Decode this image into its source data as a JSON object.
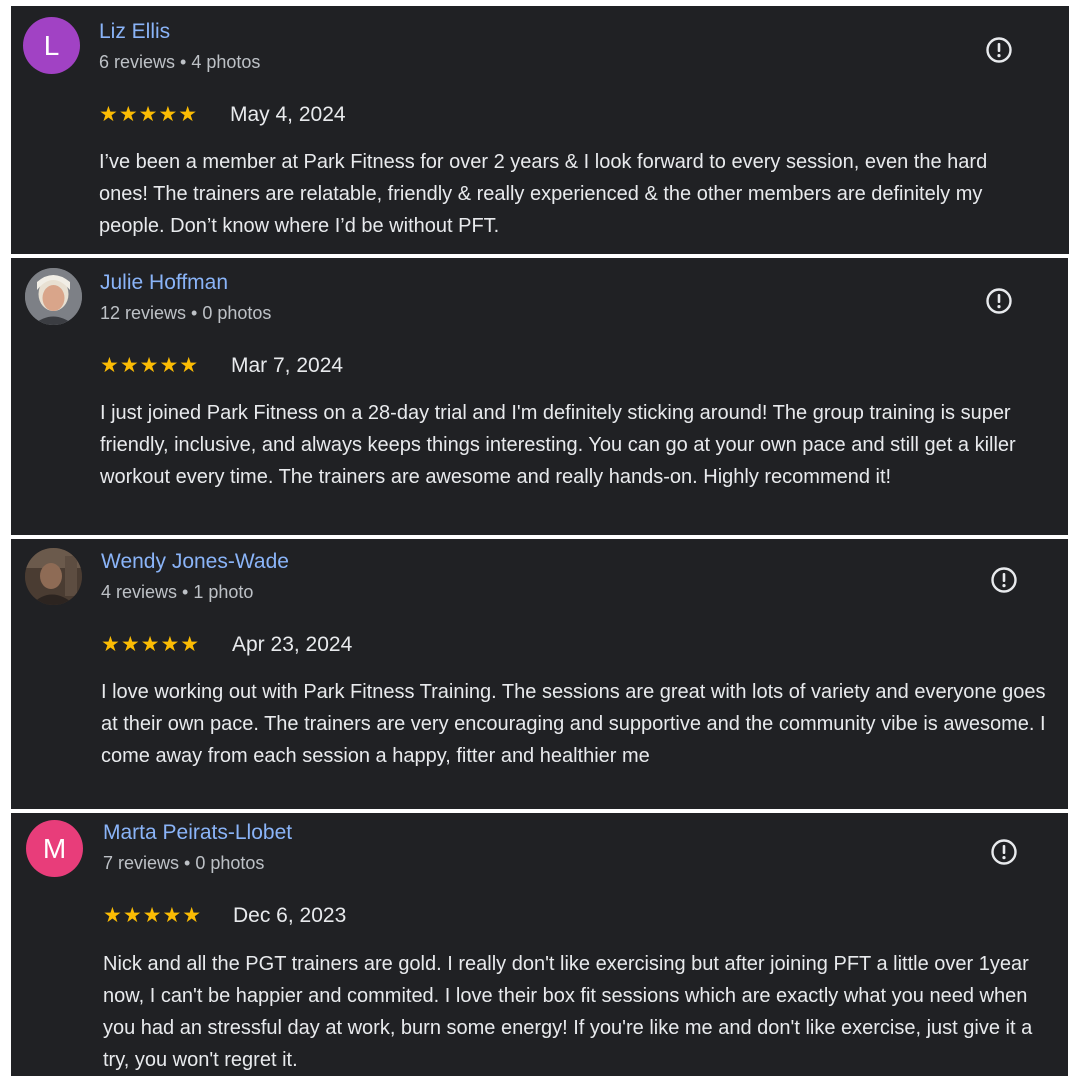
{
  "colors": {
    "card_background": "#202124",
    "reviewer_name": "#8ab4f8",
    "meta_text": "#bdc1c6",
    "body_text": "#e8eaed",
    "star": "#fbbc04",
    "avatar_purple": "#a142c4",
    "avatar_pink": "#e83d7a"
  },
  "reviews": [
    {
      "initial": "L",
      "name": "Liz Ellis",
      "meta": "6 reviews • 4 photos",
      "stars": "★★★★★",
      "rating": 5,
      "date": "May 4, 2024",
      "text": "I’ve been a member at Park Fitness for over 2 years & I look forward to every session, even the hard ones! The trainers are relatable, friendly & really experienced & the other members are definitely my people. Don’t know where I’d be without PFT."
    },
    {
      "initial": "",
      "name": "Julie Hoffman",
      "meta": "12 reviews • 0 photos",
      "stars": "★★★★★",
      "rating": 5,
      "date": "Mar 7, 2024",
      "text": "I just joined Park Fitness on a 28-day trial and I'm definitely sticking around! The group training is super friendly, inclusive, and always keeps things interesting. You can go at your own pace and still get a killer workout every time. The trainers are awesome and really hands-on. Highly recommend it!"
    },
    {
      "initial": "",
      "name": "Wendy Jones-Wade",
      "meta": "4 reviews • 1 photo",
      "stars": "★★★★★",
      "rating": 5,
      "date": "Apr 23, 2024",
      "text": "I love working out with Park Fitness Training. The sessions are great with lots of variety and everyone goes at their own pace. The trainers are very encouraging and supportive and the community vibe is awesome. I come away from each session a happy, fitter and healthier me"
    },
    {
      "initial": "M",
      "name": "Marta Peirats-Llobet",
      "meta": "7 reviews • 0 photos",
      "stars": "★★★★★",
      "rating": 5,
      "date": "Dec 6, 2023",
      "text": "Nick and all the PGT trainers are gold. I really don't like exercising but after joining PFT a little over 1year now, I can't be happier and commited. I love their box fit sessions which are exactly what you need when you had an stressful day at work, burn some energy! If you're like me and don't like exercise, just give it a try, you won't regret it."
    }
  ]
}
